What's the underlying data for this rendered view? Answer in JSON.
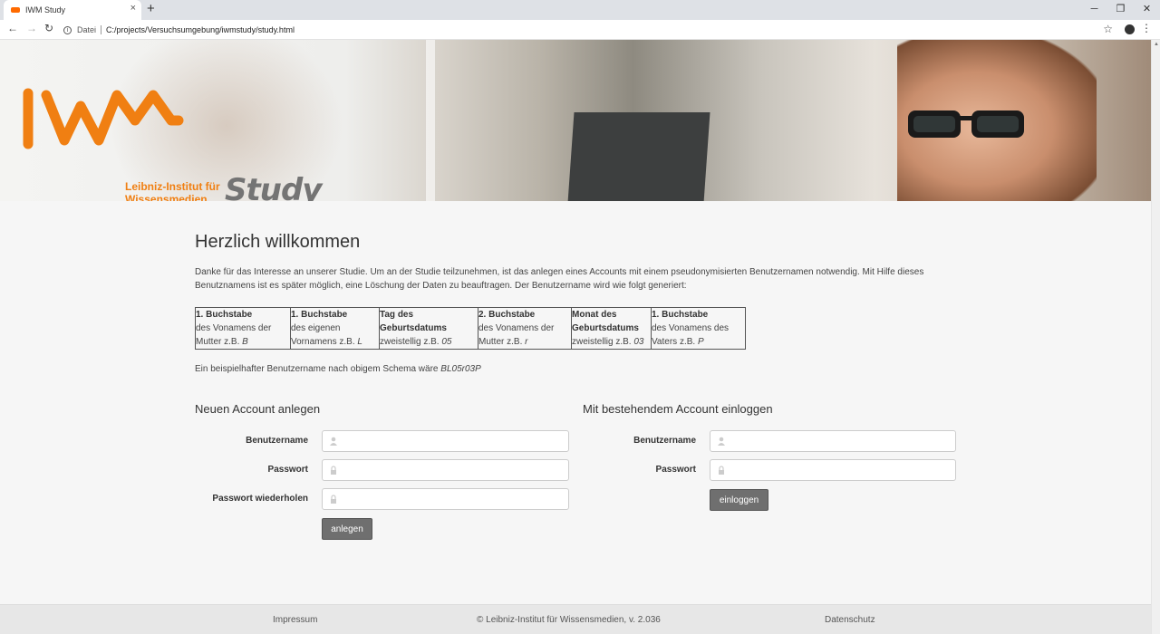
{
  "browser": {
    "tab_title": "IWM Study",
    "tab_close": "×",
    "new_tab": "+",
    "scheme_label": "Datei",
    "url": "C:/projects/Versuchsumgebung/iwmstudy/study.html",
    "window_controls": [
      "─",
      "❐",
      "✕"
    ]
  },
  "header": {
    "logo_line1": "Leibniz-Institut für",
    "logo_line2": "Wissensmedien",
    "logo_study": "Study",
    "brand_color": "#f07f12"
  },
  "main": {
    "title": "Herzlich willkommen",
    "intro": "Danke für das Interesse an unserer Studie. Um an der Studie teilzunehmen, ist das anlegen eines Accounts mit einem pseudonymisierten Benutzernamen notwendig. Mit Hilfe dieses Benutznamens ist es später möglich, eine Löschung der Daten zu beauftragen. Der Benutzername wird wie folgt generiert:",
    "schema": [
      {
        "head": "1. Buchstabe",
        "desc": "des Vonamens der Mutter z.B.",
        "ex": "B"
      },
      {
        "head": "1. Buchstabe",
        "desc": "des eigenen Vornamens z.B.",
        "ex": "L"
      },
      {
        "head": "Tag des Geburtsdatums",
        "desc": "zweistellig z.B.",
        "ex": "05"
      },
      {
        "head": "2. Buchstabe",
        "desc": "des Vonamens der Mutter z.B.",
        "ex": "r"
      },
      {
        "head": "Monat des Geburtsdatums",
        "desc": "zweistellig z.B.",
        "ex": "03"
      },
      {
        "head": "1. Buchstabe",
        "desc": "des Vonamens des Vaters z.B.",
        "ex": "P"
      }
    ],
    "example_text": "Ein beispielhafter Benutzername nach obigem Schema wäre",
    "example_value": "BL05r03P"
  },
  "register": {
    "title": "Neuen Account anlegen",
    "username_label": "Benutzername",
    "password_label": "Passwort",
    "password_repeat_label": "Passwort wiederholen",
    "username_value": "",
    "password_value": "",
    "password_repeat_value": "",
    "submit_label": "anlegen"
  },
  "login": {
    "title": "Mit bestehendem Account einloggen",
    "username_label": "Benutzername",
    "password_label": "Passwort",
    "username_value": "",
    "password_value": "",
    "submit_label": "einloggen"
  },
  "footer": {
    "imprint": "Impressum",
    "copyright": "© Leibniz-Institut für Wissensmedien, v. 2.036",
    "privacy": "Datenschutz"
  },
  "icons": {
    "back": "back-arrow-icon",
    "forward": "forward-arrow-icon",
    "reload": "reload-icon",
    "user": "user-icon",
    "lock": "lock-icon"
  }
}
